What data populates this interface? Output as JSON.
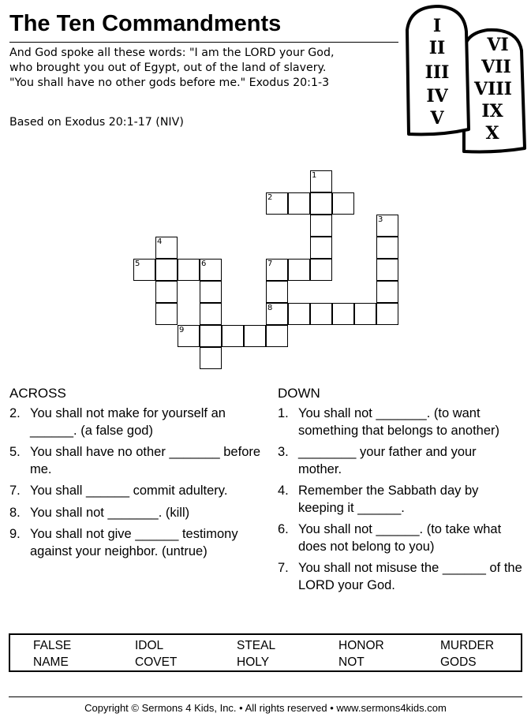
{
  "header": {
    "title": "The Ten Commandments",
    "intro_lines": [
      "And God spoke all these words: \"I am the LORD your God,",
      "who brought you out of Egypt, out of the land of slavery.",
      "\"You shall have no other gods before me.\" Exodus 20:1-3"
    ],
    "based_on": "Based on Exodus 20:1-17 (NIV)"
  },
  "illustration": {
    "name": "stone-tablets",
    "left_tablet_numerals": [
      "I",
      "II",
      "III",
      "IV",
      "V"
    ],
    "right_tablet_numerals": [
      "VI",
      "VII",
      "VIII",
      "IX",
      "X"
    ]
  },
  "crossword": {
    "cells": [
      {
        "row": 0,
        "col": 8,
        "num": "1"
      },
      {
        "row": 1,
        "col": 6,
        "num": "2"
      },
      {
        "row": 1,
        "col": 7
      },
      {
        "row": 1,
        "col": 8
      },
      {
        "row": 1,
        "col": 9
      },
      {
        "row": 2,
        "col": 8
      },
      {
        "row": 2,
        "col": 11,
        "num": "3"
      },
      {
        "row": 3,
        "col": 1,
        "num": "4"
      },
      {
        "row": 3,
        "col": 8
      },
      {
        "row": 3,
        "col": 11
      },
      {
        "row": 4,
        "col": 0,
        "num": "5"
      },
      {
        "row": 4,
        "col": 1
      },
      {
        "row": 4,
        "col": 2
      },
      {
        "row": 4,
        "col": 3,
        "num": "6"
      },
      {
        "row": 4,
        "col": 6,
        "num": "7"
      },
      {
        "row": 4,
        "col": 7
      },
      {
        "row": 4,
        "col": 8
      },
      {
        "row": 4,
        "col": 11
      },
      {
        "row": 5,
        "col": 1
      },
      {
        "row": 5,
        "col": 3
      },
      {
        "row": 5,
        "col": 6
      },
      {
        "row": 5,
        "col": 11
      },
      {
        "row": 6,
        "col": 1
      },
      {
        "row": 6,
        "col": 3
      },
      {
        "row": 6,
        "col": 6,
        "num": "8"
      },
      {
        "row": 6,
        "col": 7
      },
      {
        "row": 6,
        "col": 8
      },
      {
        "row": 6,
        "col": 9
      },
      {
        "row": 6,
        "col": 10
      },
      {
        "row": 6,
        "col": 11
      },
      {
        "row": 7,
        "col": 2,
        "num": "9"
      },
      {
        "row": 7,
        "col": 3
      },
      {
        "row": 7,
        "col": 4
      },
      {
        "row": 7,
        "col": 5
      },
      {
        "row": 7,
        "col": 6
      },
      {
        "row": 8,
        "col": 3
      }
    ]
  },
  "clues": {
    "across_heading": "ACROSS",
    "across": [
      {
        "num": "2.",
        "text": "You shall not make for yourself an ______. (a false god)"
      },
      {
        "num": "5.",
        "text": "You shall have no other _______ before me."
      },
      {
        "num": "7.",
        "text": "You shall ______ commit adultery."
      },
      {
        "num": "8.",
        "text": "You shall not _______. (kill)"
      },
      {
        "num": "9.",
        "text": "You shall not give ______ testimony against your neighbor. (untrue)"
      }
    ],
    "down_heading": "DOWN",
    "down": [
      {
        "num": "1.",
        "text": "You shall not _______. (to want something that belongs to another)"
      },
      {
        "num": "3.",
        "text": "________ your father and your mother."
      },
      {
        "num": "4.",
        "text": "Remember the Sabbath day by keeping it ______."
      },
      {
        "num": "6.",
        "text": "You shall not ______. (to take what does not belong to you)"
      },
      {
        "num": "7.",
        "text": "You shall not misuse the ______ of the LORD your God."
      }
    ]
  },
  "word_bank": {
    "rows": [
      [
        "FALSE",
        "IDOL",
        "STEAL",
        "HONOR",
        "MURDER"
      ],
      [
        "NAME",
        "COVET",
        "HOLY",
        "NOT",
        "GODS"
      ]
    ]
  },
  "footer": {
    "copyright": "Copyright © Sermons 4 Kids, Inc. • All rights reserved • www.sermons4kids.com"
  }
}
